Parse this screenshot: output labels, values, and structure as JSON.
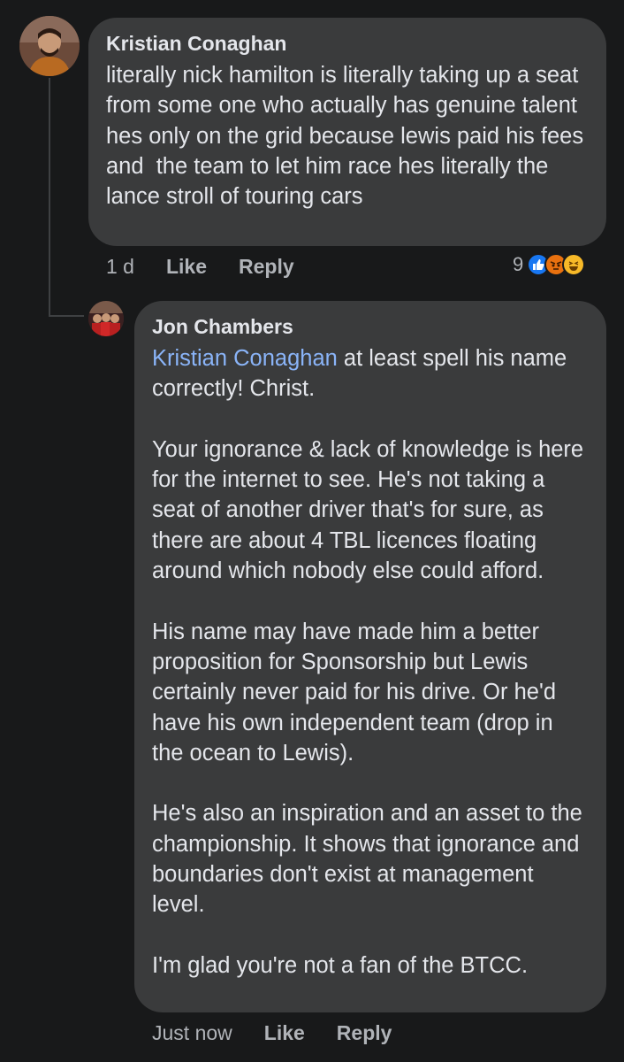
{
  "comments": [
    {
      "author": "Kristian Conaghan",
      "text": "literally nick hamilton is literally taking up a seat from some one who actually has genuine talent hes only on the grid because lewis paid his fees and  the team to let him race hes literally the lance stroll of touring cars",
      "time": "1 d",
      "like_label": "Like",
      "reply_label": "Reply",
      "reaction_count": "9",
      "reactions": [
        "like-icon",
        "angry-icon",
        "haha-icon"
      ]
    },
    {
      "author": "Jon Chambers",
      "mention": "Kristian Conaghan",
      "text": " at least spell his name correctly! Christ.\n\nYour ignorance & lack of knowledge is here for the internet to see. He's not taking a seat of another driver that's for sure, as there are about 4 TBL licences floating around which nobody else could afford.\n\nHis name may have made him a better proposition for Sponsorship but Lewis certainly never paid for his drive. Or he'd have his own independent team (drop in the ocean to Lewis).\n\nHe's also an inspiration and an asset to the championship. It shows that ignorance and boundaries don't exist at management level.\n\nI'm glad you're not a fan of the BTCC.",
      "time": "Just now",
      "like_label": "Like",
      "reply_label": "Reply"
    }
  ],
  "colors": {
    "background": "#18191a",
    "bubble": "#3a3b3c",
    "mention": "#8ab4f8",
    "like_reaction": "#1877f2"
  }
}
